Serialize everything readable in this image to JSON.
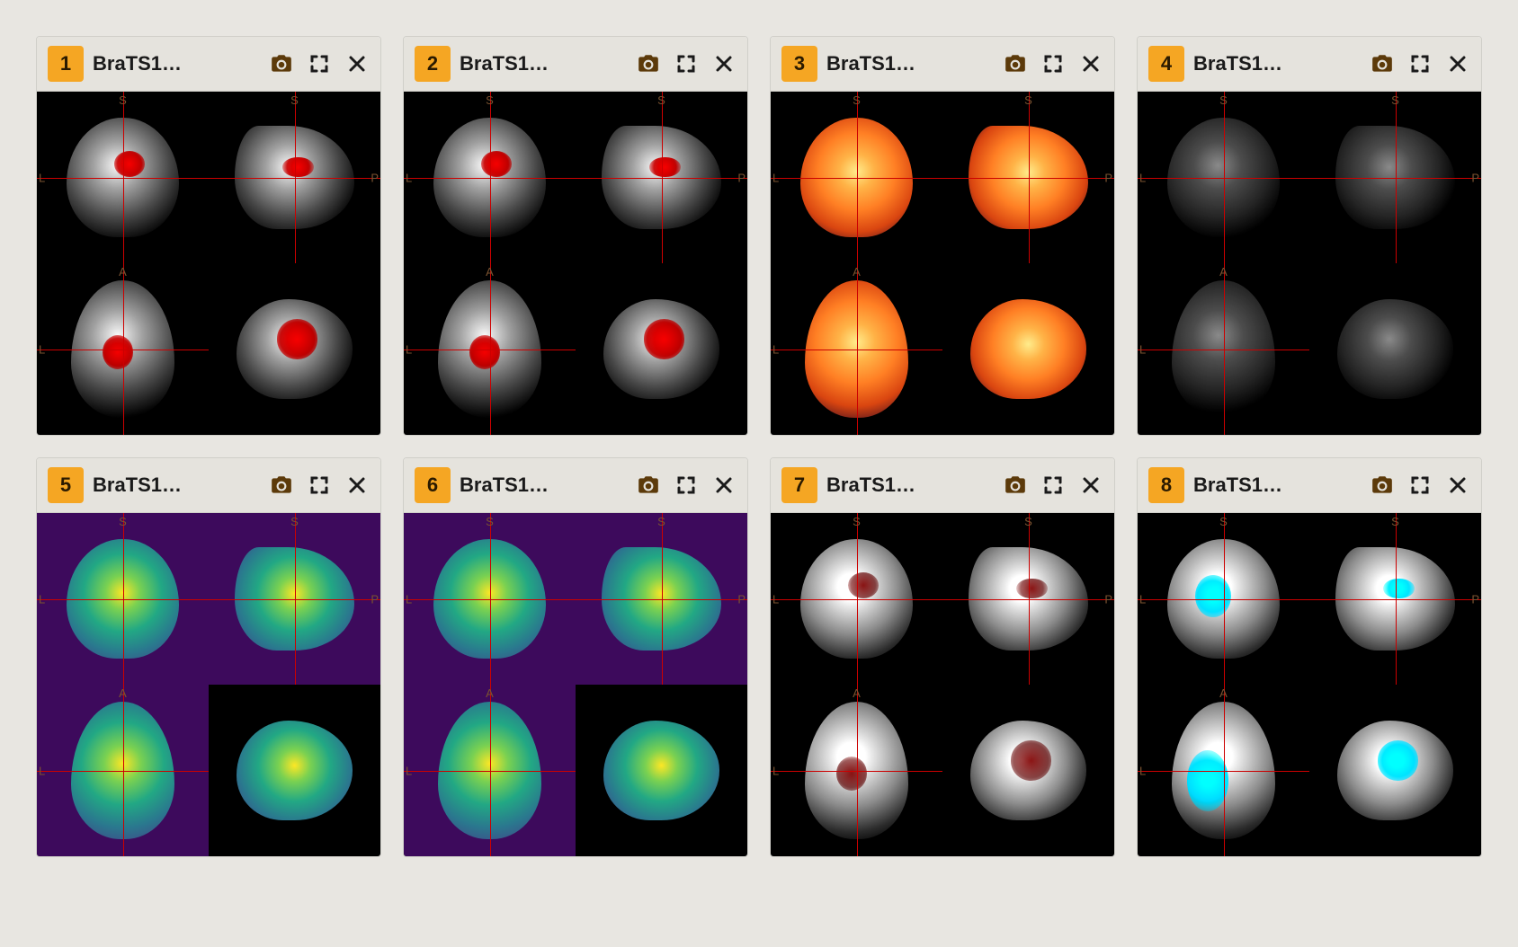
{
  "panels": [
    {
      "number": "1",
      "title": "BraTS1…",
      "palette": "gray",
      "overlay_color": "red",
      "overlay": true,
      "bg": "black",
      "crosshair": true,
      "orient": {
        "tl_top": "S",
        "tl_left": "L",
        "tr_top": "S",
        "tr_right": "P",
        "bl_top": "A",
        "bl_left": "L"
      }
    },
    {
      "number": "2",
      "title": "BraTS1…",
      "palette": "gray",
      "overlay_color": "red",
      "overlay": true,
      "bg": "black",
      "crosshair": true,
      "orient": {
        "tl_top": "S",
        "tl_left": "L",
        "tr_top": "S",
        "tr_right": "P",
        "bl_top": "A",
        "bl_left": "L"
      }
    },
    {
      "number": "3",
      "title": "BraTS1…",
      "palette": "hot",
      "overlay_color": "none",
      "overlay": false,
      "bg": "black",
      "crosshair": true,
      "orient": {
        "tl_top": "S",
        "tl_left": "L",
        "tr_top": "S",
        "tr_right": "P",
        "bl_top": "A",
        "bl_left": "L"
      }
    },
    {
      "number": "4",
      "title": "BraTS1…",
      "palette": "gray-dark",
      "overlay_color": "none",
      "overlay": false,
      "bg": "black",
      "crosshair": true,
      "orient": {
        "tl_top": "S",
        "tl_left": "L",
        "tr_top": "S",
        "tr_right": "P",
        "bl_top": "A",
        "bl_left": "L"
      }
    },
    {
      "number": "5",
      "title": "BraTS1…",
      "palette": "viridis",
      "overlay_color": "none",
      "overlay": false,
      "bg": "purple",
      "crosshair": true,
      "orient": {
        "tl_top": "S",
        "tl_left": "L",
        "tr_top": "S",
        "tr_right": "P",
        "bl_top": "A",
        "bl_left": "L"
      }
    },
    {
      "number": "6",
      "title": "BraTS1…",
      "palette": "viridis",
      "overlay_color": "none",
      "overlay": false,
      "bg": "purple",
      "crosshair": true,
      "orient": {
        "tl_top": "S",
        "tl_left": "L",
        "tr_top": "S",
        "tr_right": "P",
        "bl_top": "A",
        "bl_left": "L"
      }
    },
    {
      "number": "7",
      "title": "BraTS1…",
      "palette": "gray-bright",
      "overlay_color": "darkred",
      "overlay": true,
      "bg": "black",
      "crosshair": true,
      "orient": {
        "tl_top": "S",
        "tl_left": "L",
        "tr_top": "S",
        "tr_right": "P",
        "bl_top": "A",
        "bl_left": "L"
      }
    },
    {
      "number": "8",
      "title": "BraTS1…",
      "palette": "gray-bright",
      "overlay_color": "cyan",
      "overlay": true,
      "bg": "black",
      "crosshair": true,
      "orient": {
        "tl_top": "S",
        "tl_left": "L",
        "tr_top": "S",
        "tr_right": "P",
        "bl_top": "A",
        "bl_left": "L"
      }
    }
  ],
  "icons": {
    "camera": "camera-icon",
    "fullscreen": "fullscreen-icon",
    "close": "close-icon"
  }
}
